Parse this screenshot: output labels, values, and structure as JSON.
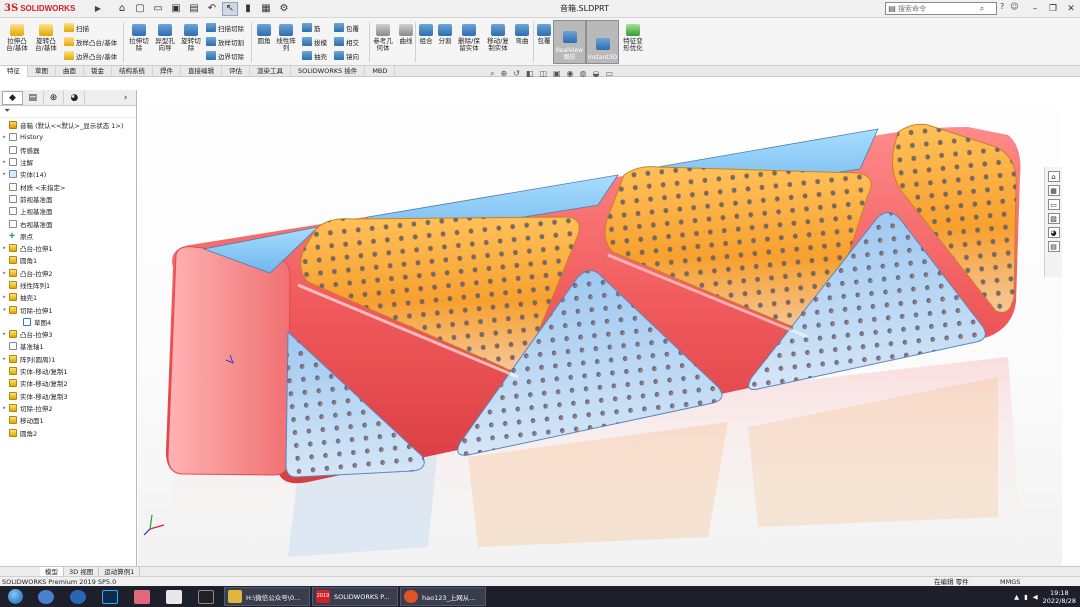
{
  "app": {
    "logo_mark": "3S",
    "logo_text": "SOLIDWORKS",
    "doc_title": "音箱.SLDPRT",
    "search_placeholder": "搜索命令"
  },
  "ribbon": {
    "big_commands": [
      {
        "label1": "拉伸凸",
        "label2": "台/基体"
      },
      {
        "label1": "旋转凸",
        "label2": "台/基体"
      },
      {
        "label1": "拉伸切",
        "label2": "除"
      },
      {
        "label1": "异型孔",
        "label2": "向导"
      },
      {
        "label1": "旋转切",
        "label2": "除"
      },
      {
        "label1": "圆角",
        "label2": ""
      },
      {
        "label1": "线性阵",
        "label2": "列"
      },
      {
        "label1": "参考几",
        "label2": "何体"
      },
      {
        "label1": "曲线",
        "label2": ""
      },
      {
        "label1": "组合",
        "label2": ""
      },
      {
        "label1": "分割",
        "label2": ""
      },
      {
        "label1": "删除/保",
        "label2": "留实体"
      },
      {
        "label1": "移动/复",
        "label2": "制实体"
      },
      {
        "label1": "弯曲",
        "label2": ""
      },
      {
        "label1": "包覆",
        "label2": ""
      },
      {
        "label1": "特征变",
        "label2": "形优化"
      }
    ],
    "small_commands": [
      "扫描",
      "放样凸台/基体",
      "边界凸台/基体",
      "扫描切除",
      "放样切割",
      "边界切除",
      "筋",
      "拔模",
      "抽壳",
      "包覆",
      "相交",
      "镜向"
    ],
    "realview": {
      "label1": "RealView",
      "label2": "图形"
    },
    "instant3d": {
      "label1": "Instant3D",
      "label2": ""
    }
  },
  "tabs": [
    "特征",
    "草图",
    "曲面",
    "钣金",
    "结构系统",
    "焊件",
    "直接编辑",
    "评估",
    "渲染工具",
    "SOLIDWORKS 插件",
    "MBD"
  ],
  "tree": {
    "root": "音箱 (默认<<默认>_显示状态 1>)",
    "items": [
      {
        "label": "History",
        "twisty": "▸",
        "icon": "plane"
      },
      {
        "label": "传感器",
        "twisty": "",
        "icon": "plane"
      },
      {
        "label": "注解",
        "twisty": "▸",
        "icon": "plane"
      },
      {
        "label": "实体(14)",
        "twisty": "▸",
        "icon": "box"
      },
      {
        "label": "材质 <未指定>",
        "twisty": "",
        "icon": "plane"
      },
      {
        "label": "前视基准面",
        "twisty": "",
        "icon": "plane"
      },
      {
        "label": "上视基准面",
        "twisty": "",
        "icon": "plane"
      },
      {
        "label": "右视基准面",
        "twisty": "",
        "icon": "plane"
      },
      {
        "label": "原点",
        "twisty": "",
        "icon": "pt"
      },
      {
        "label": "凸台-拉伸1",
        "twisty": "▸",
        "icon": "feat"
      },
      {
        "label": "圆角1",
        "twisty": "",
        "icon": "feat"
      },
      {
        "label": "凸台-拉伸2",
        "twisty": "▸",
        "icon": "feat"
      },
      {
        "label": "线性阵列1",
        "twisty": "",
        "icon": "feat"
      },
      {
        "label": "抽壳1",
        "twisty": "▸",
        "icon": "feat"
      },
      {
        "label": "切除-拉伸1",
        "twisty": "▾",
        "icon": "feat"
      },
      {
        "label": "草图4",
        "twisty": "",
        "icon": "sk",
        "indent": true
      },
      {
        "label": "凸台-拉伸3",
        "twisty": "▸",
        "icon": "feat"
      },
      {
        "label": "基准轴1",
        "twisty": "",
        "icon": "plane"
      },
      {
        "label": "阵列(圆周)1",
        "twisty": "▸",
        "icon": "feat"
      },
      {
        "label": "实体-移动/复制1",
        "twisty": "",
        "icon": "feat"
      },
      {
        "label": "实体-移动/复制2",
        "twisty": "",
        "icon": "feat"
      },
      {
        "label": "实体-移动/复制3",
        "twisty": "",
        "icon": "feat"
      },
      {
        "label": "切除-拉伸2",
        "twisty": "▸",
        "icon": "feat"
      },
      {
        "label": "移动面1",
        "twisty": "",
        "icon": "feat"
      },
      {
        "label": "圆角2",
        "twisty": "",
        "icon": "feat"
      }
    ]
  },
  "bottom_tabs": [
    "模型",
    "3D 视图",
    "运动算例1"
  ],
  "status": {
    "left": "SOLIDWORKS Premium 2019 SP5.0",
    "mode": "在编辑 零件",
    "units": "MMGS"
  },
  "taskbar": {
    "apps": [
      {
        "label": "H:\\微信公众号\\0...",
        "color": "#e0b640"
      },
      {
        "label": "SOLIDWORKS P...",
        "color": "#c8252b",
        "badge": "2019"
      },
      {
        "label": "hao123_上网从...",
        "color": "#e0522a"
      }
    ],
    "time": "19:18",
    "date": "2022/8/28"
  },
  "colors": {
    "body_red": "#f0585a",
    "panel_orange": "#f7a638",
    "panel_blue": "#8cc8ef",
    "hole": "#3f6fc0"
  }
}
